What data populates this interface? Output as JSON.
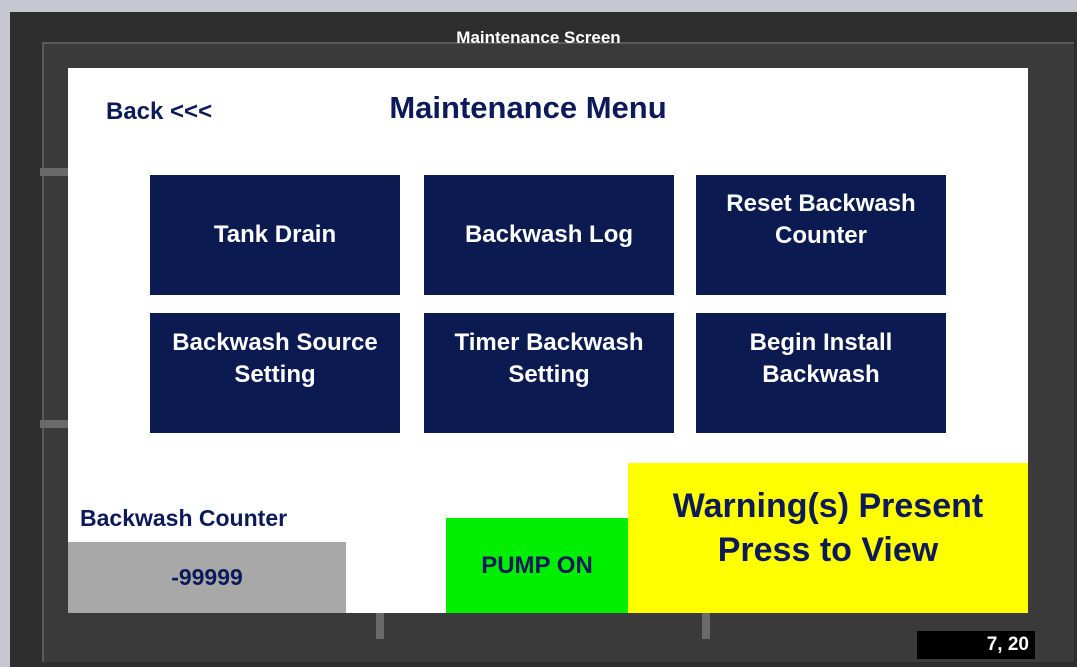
{
  "window": {
    "title": "Maintenance Screen"
  },
  "screen": {
    "back_label": "Back <<<",
    "title": "Maintenance Menu",
    "tiles": [
      {
        "label": "Tank Drain"
      },
      {
        "label": "Backwash Log"
      },
      {
        "label": "Reset Backwash\nCounter"
      },
      {
        "label": "Backwash Source\nSetting"
      },
      {
        "label": "Timer Backwash\nSetting"
      },
      {
        "label": "Begin Install\nBackwash"
      }
    ],
    "counter": {
      "label": "Backwash Counter",
      "value": "-99999"
    },
    "pump_status": "PUMP ON",
    "warning": "Warning(s) Present\nPress to View"
  },
  "status": {
    "coords": "7, 20"
  },
  "colors": {
    "tile_bg": "#0b1a50",
    "text_navy": "#0d1a5a",
    "pump_green": "#00ee00",
    "warning_yellow": "#ffff00",
    "counter_gray": "#a8a8a8"
  }
}
